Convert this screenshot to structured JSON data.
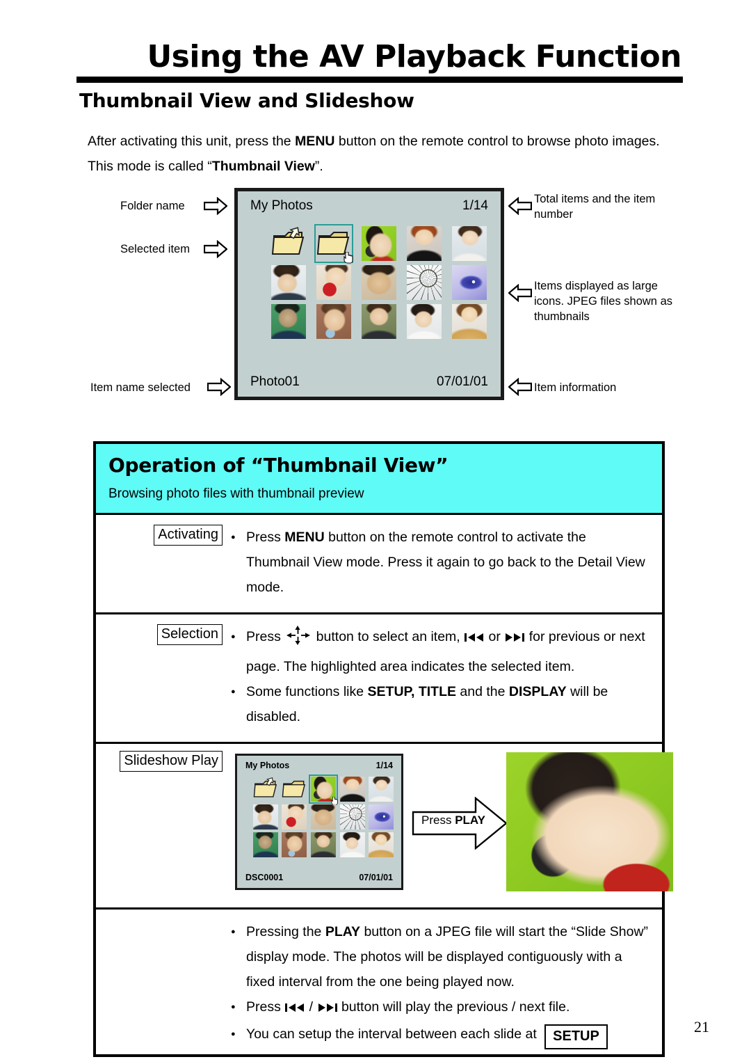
{
  "header": {
    "title": "Using the AV Playback Function",
    "section_title": "Thumbnail View and Slideshow"
  },
  "intro": {
    "part1": "After activating this unit, press the ",
    "menu": "MENU",
    "part2": " button on the remote control to browse photo images. This mode is called “",
    "thumbnail_view": "Thumbnail View",
    "part3": "”."
  },
  "diagram": {
    "callouts": {
      "folder_name": "Folder name",
      "selected_item": "Selected item",
      "item_name_selected": "Item name selected",
      "total_items": "Total items and the item number",
      "large_icons": "Items displayed as large icons. JPEG files shown as thumbnails",
      "item_information": "Item information"
    },
    "screen": {
      "folder_title": "My Photos",
      "counter": "1/14",
      "file_name": "Photo01",
      "date": "07/01/01",
      "selected_index": 1,
      "items": [
        {
          "type": "folder-up",
          "name": "parent-folder-icon"
        },
        {
          "type": "folder",
          "name": "folder-icon"
        },
        {
          "type": "photo",
          "name": "photo-man-green-bg"
        },
        {
          "type": "photo",
          "name": "photo-redhair-woman"
        },
        {
          "type": "photo",
          "name": "photo-woman-white"
        },
        {
          "type": "photo",
          "name": "photo-young-man"
        },
        {
          "type": "photo",
          "name": "photo-woman-strawberry"
        },
        {
          "type": "photo",
          "name": "photo-man-glasses"
        },
        {
          "type": "photo",
          "name": "photo-bicycle-wheel"
        },
        {
          "type": "photo",
          "name": "photo-blue-eye"
        },
        {
          "type": "photo",
          "name": "photo-man-green"
        },
        {
          "type": "photo",
          "name": "photo-woman-brick"
        },
        {
          "type": "photo",
          "name": "photo-woman-smiling"
        },
        {
          "type": "photo",
          "name": "photo-woman-phone"
        },
        {
          "type": "photo",
          "name": "photo-woman-blonde"
        }
      ]
    }
  },
  "operation": {
    "heading": "Operation of “Thumbnail View”",
    "subheading": "Browsing photo files with thumbnail preview",
    "rows": [
      {
        "label": "Activating",
        "bullets": [
          {
            "segments": [
              {
                "t": "Press ",
                "b": false
              },
              {
                "t": "MENU",
                "b": true
              },
              {
                "t": " button on the remote control to activate the Thumbnail View mode. Press it again to go back to the Detail View mode.",
                "b": false
              }
            ]
          }
        ]
      },
      {
        "label": "Selection",
        "bullets": [
          {
            "segments": [
              {
                "t": "Press ",
                "b": false
              },
              {
                "t": "[nav-cross]",
                "b": false
              },
              {
                "t": " button to select an item, ",
                "b": false
              },
              {
                "t": "[prev]",
                "b": false
              },
              {
                "t": " or ",
                "b": false
              },
              {
                "t": "[next]",
                "b": false
              },
              {
                "t": " for previous or next page. The highlighted area indicates the selected item.",
                "b": false
              }
            ]
          },
          {
            "segments": [
              {
                "t": "Some functions like ",
                "b": false
              },
              {
                "t": "SETUP, TITLE",
                "b": true
              },
              {
                "t": " and the ",
                "b": false
              },
              {
                "t": "DISPLAY",
                "b": true
              },
              {
                "t": " will be disabled.",
                "b": false
              }
            ]
          }
        ]
      }
    ],
    "slideshow": {
      "label": "Slideshow  Play",
      "press_play_prefix": "Press ",
      "press_play_bold": "PLAY",
      "screen": {
        "folder_title": "My Photos",
        "counter": "1/14",
        "file_name": "DSC0001",
        "date": "07/01/01",
        "selected_index": 2
      },
      "bullets": [
        {
          "segments": [
            {
              "t": "Pressing the ",
              "b": false
            },
            {
              "t": "PLAY",
              "b": true
            },
            {
              "t": " button on a JPEG file will start the “Slide Show” display mode. The photos will be displayed contiguously with a fixed interval from the one being played now.",
              "b": false
            }
          ]
        },
        {
          "segments": [
            {
              "t": "Press ",
              "b": false
            },
            {
              "t": "[prev]",
              "b": false
            },
            {
              "t": " / ",
              "b": false
            },
            {
              "t": "[next]",
              "b": false
            },
            {
              "t": " button will play the previous / next file.",
              "b": false
            }
          ]
        },
        {
          "segments": [
            {
              "t": "You can setup the interval between each slide at ",
              "b": false
            },
            {
              "t": "[setup-box]",
              "b": false
            }
          ]
        }
      ],
      "setup_label": "SETUP"
    }
  },
  "footer": {
    "page_number": "21"
  },
  "colors": {
    "accent_cyan": "#5FFBF6",
    "screen_bg": "#c3d0d0",
    "selection_outline": "#2a9d95"
  }
}
